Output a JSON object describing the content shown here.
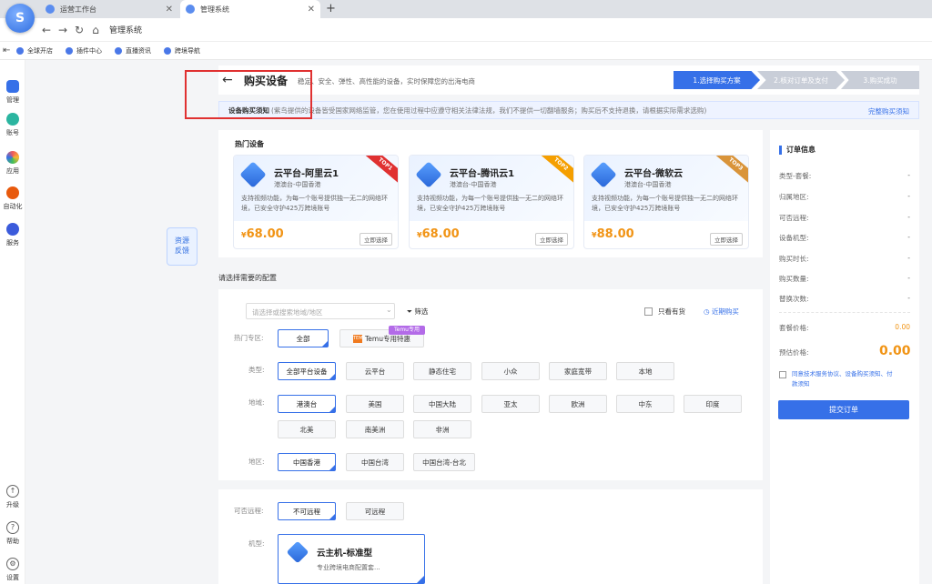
{
  "browser": {
    "tabs": [
      {
        "label": "运营工作台"
      },
      {
        "label": "管理系统"
      }
    ],
    "address": "管理系统",
    "bookmarks": [
      {
        "label": "全球开店"
      },
      {
        "label": "插件中心"
      },
      {
        "label": "直播资讯"
      },
      {
        "label": "跨境导航"
      }
    ]
  },
  "sidebar": {
    "items": [
      {
        "label": "管理"
      },
      {
        "label": "账号"
      },
      {
        "label": "应用"
      },
      {
        "label": "自动化"
      },
      {
        "label": "服务"
      }
    ],
    "bottom": [
      {
        "label": "升级"
      },
      {
        "label": "帮助"
      },
      {
        "label": "设置"
      }
    ]
  },
  "header": {
    "title": "购买设备",
    "subtitle": "稳定、安全、弹性、高性能的设备，实时保障您的出海电商",
    "steps": [
      {
        "label": "1.选择购买方案"
      },
      {
        "label": "2.核对订单及支付"
      },
      {
        "label": "3.购买成功"
      }
    ]
  },
  "notice": {
    "title": "设备购买须知",
    "text": "(紫鸟提供的设备皆受国家网络监管，您在使用过程中应遵守相关法律法规，我们不提供一切翻墙服务；购买后不支持退换，请根据实际需求选购)",
    "link": "完整购买须知"
  },
  "hot": {
    "title": "热门设备",
    "cards": [
      {
        "name": "云平台-阿里云1",
        "tag": "港澳台-中国香港",
        "desc": "支持视频功能，为每一个账号提供独一无二的网络环境，已安全守护425万跨境账号",
        "price": "68.00",
        "currency": "¥",
        "buy": "立即选择",
        "rank": "TOP1"
      },
      {
        "name": "云平台-腾讯云1",
        "tag": "港澳台-中国香港",
        "desc": "支持视频功能，为每一个账号提供独一无二的网络环境，已安全守护425万跨境账号",
        "price": "68.00",
        "currency": "¥",
        "buy": "立即选择",
        "rank": "TOP2"
      },
      {
        "name": "云平台-微软云",
        "tag": "港澳台-中国香港",
        "desc": "支持视频功能，为每一个账号提供独一无二的网络环境，已安全守护425万跨境账号",
        "price": "88.00",
        "currency": "¥",
        "buy": "立即选择",
        "rank": "TOP3"
      }
    ]
  },
  "feedback": {
    "line1": "资源",
    "line2": "反馈"
  },
  "config": {
    "title": "请选择需要的配置",
    "search_placeholder": "请选择或搜索地域/地区",
    "filter": "筛选",
    "instock": "只看有货",
    "recent": "近期购买",
    "hot_label": "热门专区:",
    "hot_options": [
      {
        "label": "全部"
      },
      {
        "label": "Temu专用特惠"
      }
    ],
    "temu_badge": "Temu专用",
    "temu_logo": "TEMU",
    "type_label": "类型:",
    "type_options": [
      {
        "label": "全部平台设备"
      },
      {
        "label": "云平台"
      },
      {
        "label": "静态住宅"
      },
      {
        "label": "小众"
      },
      {
        "label": "家庭宽带"
      },
      {
        "label": "本地"
      }
    ],
    "area_label": "地域:",
    "area_options": [
      {
        "label": "港澳台"
      },
      {
        "label": "美国"
      },
      {
        "label": "中国大陆"
      },
      {
        "label": "亚太"
      },
      {
        "label": "欧洲"
      },
      {
        "label": "中东"
      },
      {
        "label": "印度"
      },
      {
        "label": "北美"
      },
      {
        "label": "南美洲"
      },
      {
        "label": "非洲"
      }
    ],
    "region_label": "地区:",
    "region_options": [
      {
        "label": "中国香港"
      },
      {
        "label": "中国台湾"
      },
      {
        "label": "中国台湾-台北"
      }
    ],
    "remote_label": "可否远程:",
    "remote_options": [
      {
        "label": "不可远程"
      },
      {
        "label": "可远程"
      }
    ],
    "machine_label": "机型:",
    "machine": {
      "name": "云主机-标准型",
      "desc": "专业跨境电商配置套..."
    }
  },
  "order": {
    "title": "订单信息",
    "rows": [
      {
        "label": "类型-套餐:",
        "value": "-"
      },
      {
        "label": "归属地区:",
        "value": "-"
      },
      {
        "label": "可否远程:",
        "value": "-"
      },
      {
        "label": "设备机型:",
        "value": "-"
      },
      {
        "label": "购买时长:",
        "value": "-"
      },
      {
        "label": "购买数量:",
        "value": "-"
      },
      {
        "label": "替换次数:",
        "value": "-"
      }
    ],
    "package_price_label": "套餐价格:",
    "package_price": "0.00",
    "est_price_label": "预估价格:",
    "est_price": "0.00",
    "agree": "同意技术服务协议、设备购买须知、付款须知",
    "submit": "提交订单"
  }
}
